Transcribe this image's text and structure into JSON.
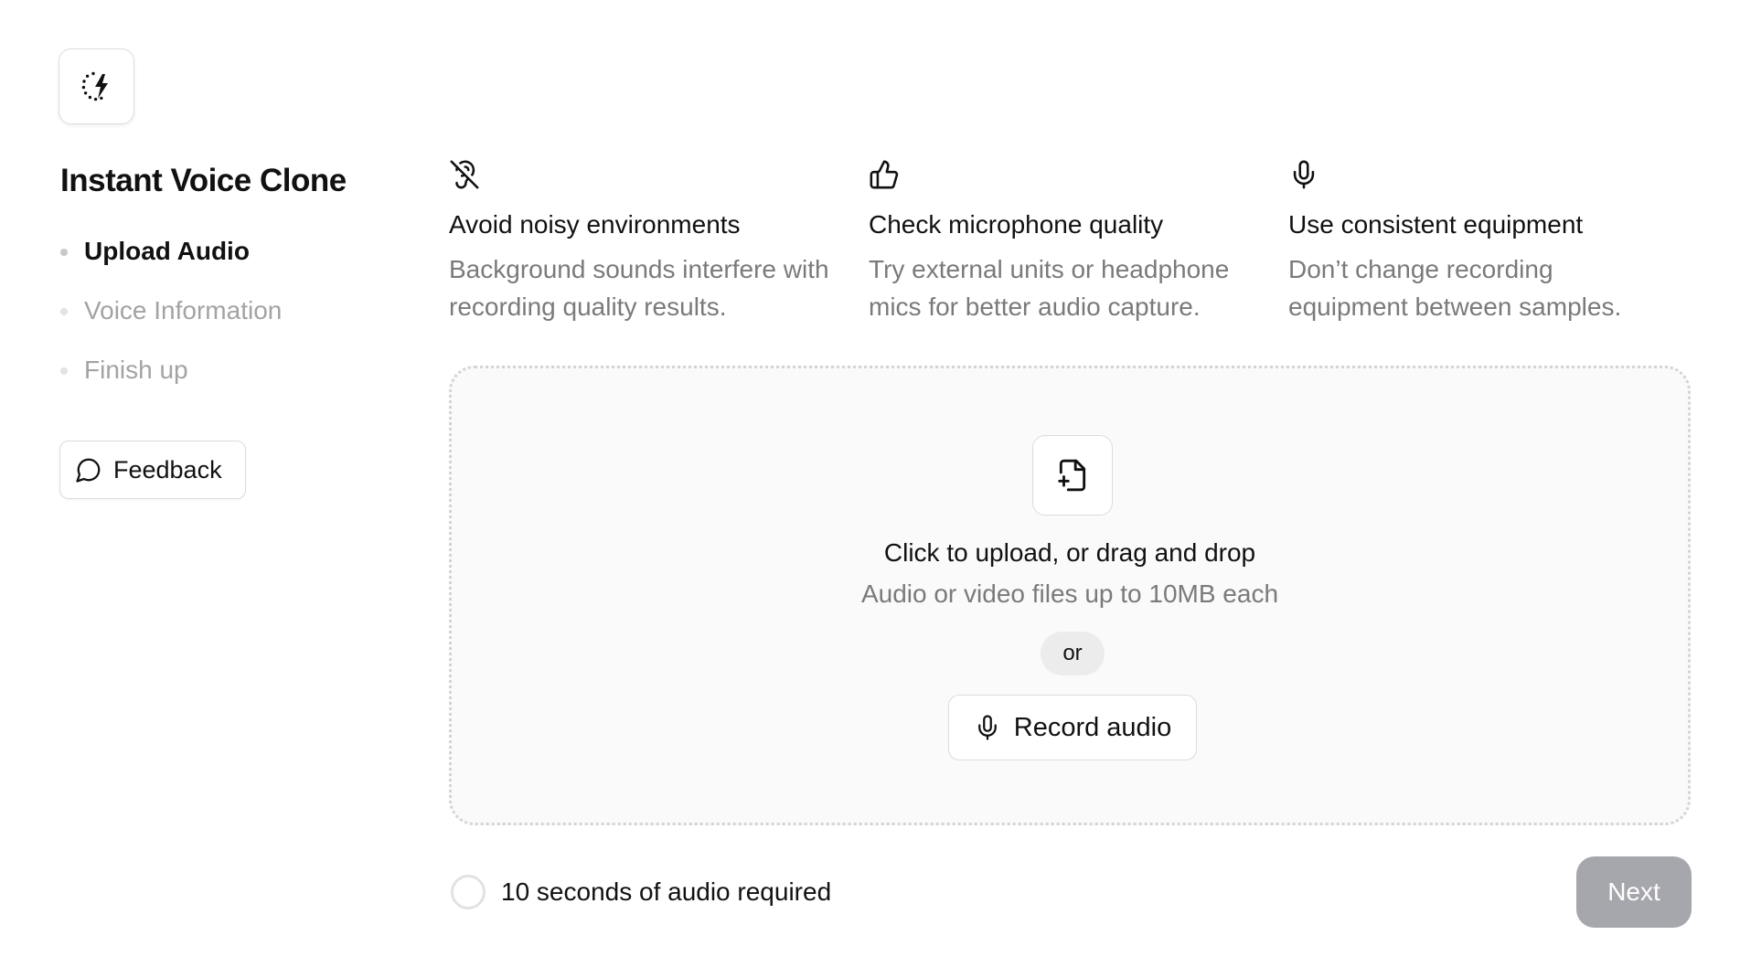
{
  "app": {
    "title": "Instant Voice Clone",
    "logo_icon": "spinner-bolt-icon"
  },
  "steps": [
    {
      "label": "Upload Audio",
      "active": true
    },
    {
      "label": "Voice Information",
      "active": false
    },
    {
      "label": "Finish up",
      "active": false
    }
  ],
  "feedback": {
    "label": "Feedback",
    "icon": "chat-bubble-icon"
  },
  "tips": [
    {
      "icon": "ear-off-icon",
      "title": "Avoid noisy environments",
      "text": "Background sounds interfere with recording quality results."
    },
    {
      "icon": "thumbs-up-icon",
      "title": "Check microphone quality",
      "text": "Try external units or headphone mics for better audio capture."
    },
    {
      "icon": "microphone-icon",
      "title": "Use consistent equipment",
      "text": "Don’t change recording equipment between samples."
    }
  ],
  "upload": {
    "icon": "file-plus-icon",
    "title": "Click to upload, or drag and drop",
    "subtitle": "Audio or video files up to 10MB each",
    "or_label": "or",
    "record_label": "Record audio"
  },
  "footer": {
    "requirement_text": "10 seconds of audio required",
    "progress": 0,
    "next_label": "Next"
  },
  "colors": {
    "accent_disabled": "#a6a6ad",
    "muted_text": "#7a7a7a",
    "dropzone_bg": "#fafafa"
  }
}
